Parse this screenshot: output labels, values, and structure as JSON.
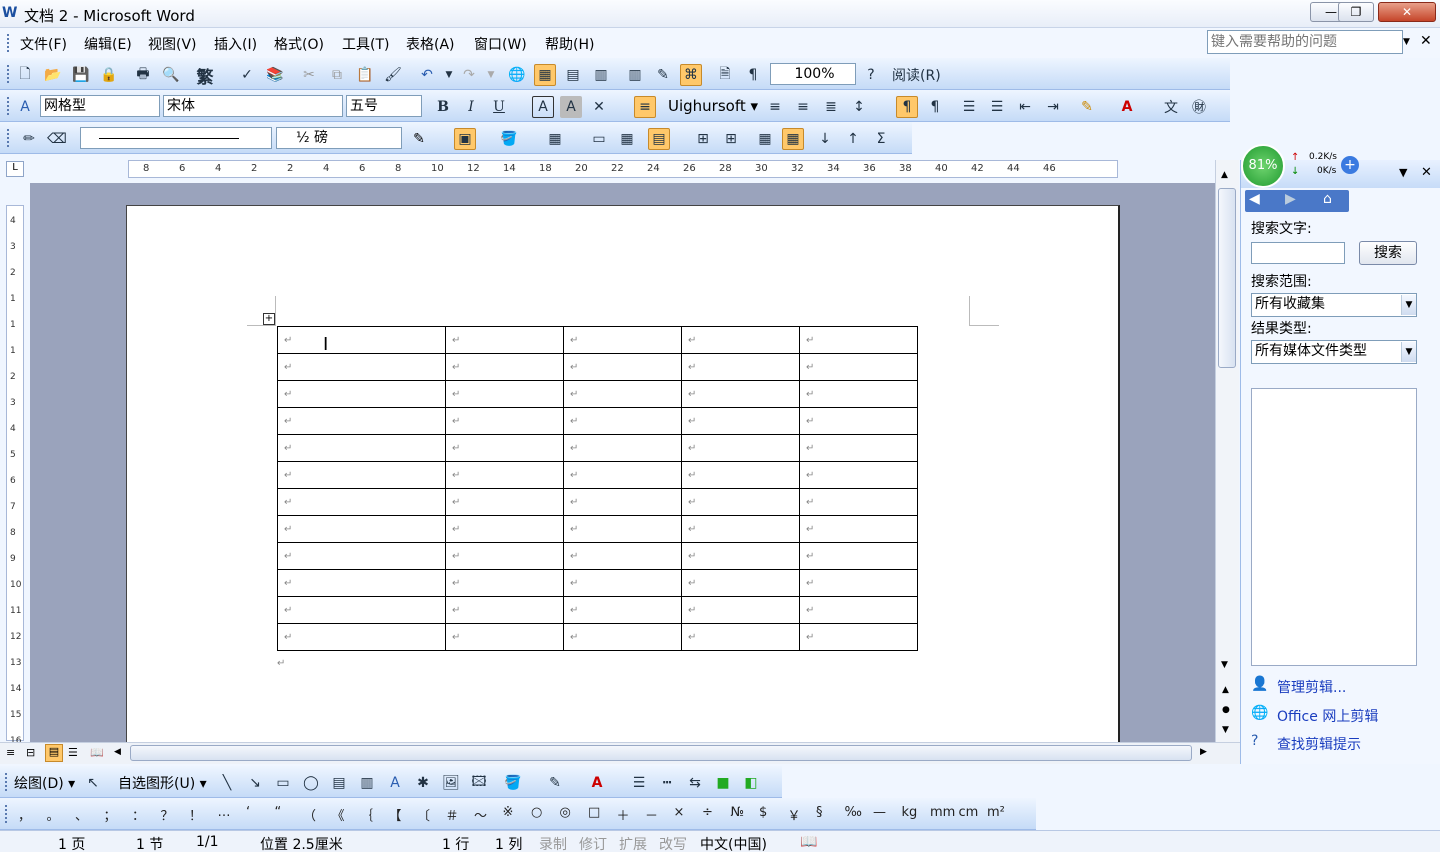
{
  "window": {
    "title": "文档 2 - Microsoft Word",
    "minimize": "—",
    "restore": "❐",
    "close": "✕"
  },
  "menubar": {
    "items": [
      "文件(F)",
      "编辑(E)",
      "视图(V)",
      "插入(I)",
      "格式(O)",
      "工具(T)",
      "表格(A)",
      "窗口(W)",
      "帮助(H)"
    ],
    "help_placeholder": "键入需要帮助的问题"
  },
  "standard": {
    "zoom": "100%",
    "reading": "阅读(R)",
    "traditional": "繁"
  },
  "formatting": {
    "style": "网格型",
    "font": "宋体",
    "size": "五号",
    "bold": "B",
    "italic": "I",
    "underline": "U",
    "rtl_font": "Uighursoft"
  },
  "tables_borders": {
    "line_weight": "½ 磅"
  },
  "ruler": {
    "h_labels": [
      "8",
      "6",
      "4",
      "2",
      "2",
      "4",
      "6",
      "8",
      "10",
      "12",
      "14",
      "18",
      "20",
      "22",
      "24",
      "26",
      "28",
      "30",
      "32",
      "34",
      "36",
      "38",
      "40",
      "42",
      "44",
      "46"
    ],
    "v_labels": [
      "4",
      "3",
      "2",
      "1",
      "1",
      "1",
      "2",
      "3",
      "4",
      "5",
      "6",
      "7",
      "8",
      "9",
      "10",
      "11",
      "12",
      "13",
      "14",
      "15",
      "16"
    ]
  },
  "table": {
    "rows": 12,
    "cols": 5,
    "cell_mark": "↵"
  },
  "taskpane": {
    "percent": "81%",
    "up_speed": "0.2K/s",
    "down_speed": "0K/s",
    "search_text_label": "搜索文字:",
    "search_button": "搜索",
    "search_in_label": "搜索范围:",
    "search_in_value": "所有收藏集",
    "result_type_label": "结果类型:",
    "result_type_value": "所有媒体文件类型",
    "link_organize": "管理剪辑...",
    "link_online": "Office 网上剪辑",
    "link_tips": "查找剪辑提示"
  },
  "drawing": {
    "draw": "绘图(D)",
    "autoshapes": "自选图形(U)"
  },
  "symbols": [
    "，",
    "。",
    "、",
    "；",
    "：",
    "？",
    "！",
    "…",
    "‘",
    "“",
    "（",
    "《",
    "｛",
    "【",
    "〔",
    "＃",
    "～",
    "※",
    "○",
    "◎",
    "□",
    "＋",
    "－",
    "×",
    "÷",
    "№",
    "$",
    "￥",
    "§",
    "‰",
    "—",
    "kg",
    "mm",
    "cm",
    "m²"
  ],
  "status": {
    "page": "1 页",
    "section": "1 节",
    "pages": "1/1",
    "position": "位置 2.5厘米",
    "line": "1 行",
    "col": "1 列",
    "rec": "录制",
    "trk": "修订",
    "ext": "扩展",
    "ovr": "改写",
    "lang": "中文(中国)"
  }
}
